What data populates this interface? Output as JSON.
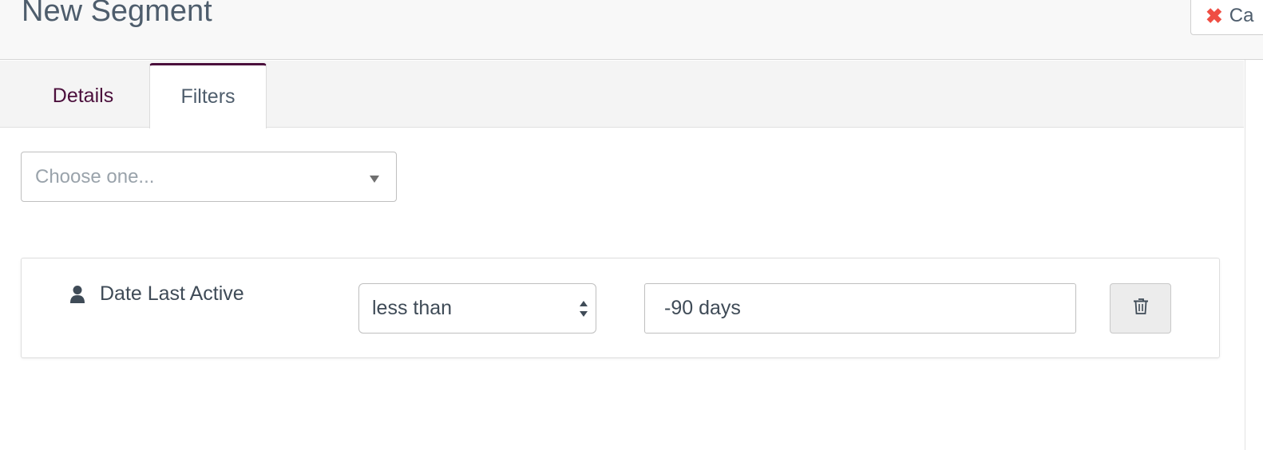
{
  "header": {
    "title": "New Segment",
    "cancel_label": "Ca",
    "cancel_icon": "close-icon"
  },
  "tabs": [
    {
      "label": "Details",
      "active": false
    },
    {
      "label": "Filters",
      "active": true
    }
  ],
  "filter_chooser": {
    "placeholder": "Choose one..."
  },
  "filter": {
    "field_icon": "user-icon",
    "field_label": "Date Last Active",
    "operator": "less than",
    "value": "-90 days",
    "delete_icon": "trash-icon"
  },
  "colors": {
    "accent": "#4b0f3c",
    "cancel_icon": "#ef4e43",
    "text": "#4e5d6c"
  }
}
